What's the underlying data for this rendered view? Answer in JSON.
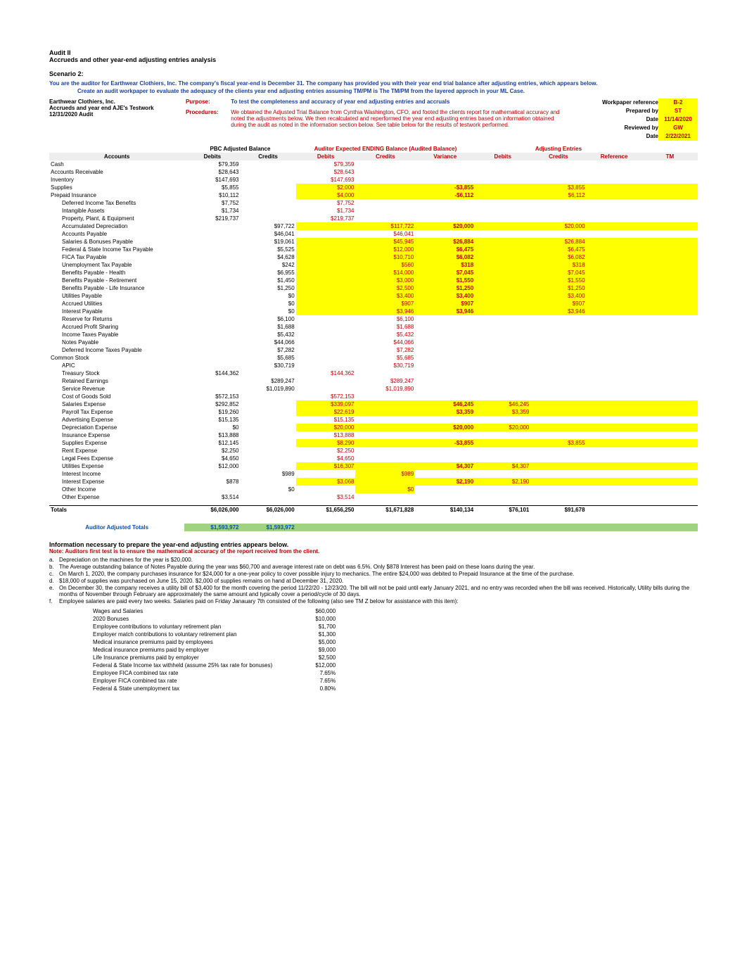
{
  "header": {
    "line1": "Audit II",
    "line2": "Accrueds and other year-end adjusting entries analysis",
    "scenario": "Scenario 2:",
    "intro1": "You are the auditor for Earthwear Clothiers, Inc. The company's fiscal year-end is December 31. The company has provided you with their year end trial balance after adjusting entries, which appears below.",
    "intro2": "Create an audit workpaper to evaluate the adequacy of the clients year end adjusting entries assuming TM/PM is The TM/PM from the layered approch in your ML Case."
  },
  "client": {
    "name": "Earthwear Clothiers, Inc.",
    "sub1": "Accrueds and year end AJE's Testwork",
    "sub2": "12/31/2020 Audit"
  },
  "purpose": {
    "label": "Purpose:",
    "text": "To test the completeness and accuracy of year end adjusting entries and accruals"
  },
  "procedures": {
    "label": "Procedures:",
    "text": "We obtained the Adjusted Trial Balance from Cynthia Washington, CFO, and footed the clients report for mathematical accuracy and noted the adjustments below.   We then recalculated and reperformed the year end adjusting entries based on information obtained during the audit as noted in the information section below.   See table below for the results of testwork performed."
  },
  "wp": {
    "labels": [
      "Workpaper reference",
      "Prepared by",
      "Date",
      "Reviewed by",
      "Date"
    ],
    "values": [
      "B-2",
      "ST",
      "11/14/2020",
      "GW",
      "2/22/2021"
    ]
  },
  "section_headers": {
    "pbc": "PBC Adjusted Balance",
    "aud": "Auditor Expected ENDING Balance (Audited Balance)",
    "adj": "Adjusting Entries"
  },
  "columns": {
    "acct": "Accounts",
    "d1": "Debits",
    "c1": "Credits",
    "d2": "Debits",
    "c2": "Credits",
    "var": "Variance",
    "d3": "Debits",
    "c3": "Credits",
    "ref": "Reference",
    "tm": "TM"
  },
  "rows": [
    {
      "acct": "Cash",
      "d1": "$79,359",
      "d2": "$79,359"
    },
    {
      "acct": "Accounts Receivable",
      "d1": "$28,643",
      "d2": "$28,643"
    },
    {
      "acct": "Inventory",
      "d1": "$147,693",
      "d2": "$147,693"
    },
    {
      "acct": "Supplies",
      "d1": "$5,855",
      "d2": "$2,000",
      "var": "-$3,855",
      "c3": "$3,855",
      "hl": "y"
    },
    {
      "acct": "Prepaid Insurance",
      "d1": "$10,112",
      "d2": "$4,000",
      "var": "-$6,112",
      "c3": "$6,112",
      "hl": "y"
    },
    {
      "acct": "Deferred Income Tax Benefits",
      "ind": true,
      "d1": "$7,752",
      "d2": "$7,752"
    },
    {
      "acct": "Intangible Assets",
      "ind": true,
      "d1": "$1,734",
      "d2": "$1,734"
    },
    {
      "acct": "Property, Plant, & Equipment",
      "ind": true,
      "d1": "$219,737",
      "d2": "$219,737"
    },
    {
      "acct": "Accumulated Depreciation",
      "ind": true,
      "c1": "$97,722",
      "c2": "$117,722",
      "var": "$20,000",
      "c3": "$20,000",
      "hl": "y"
    },
    {
      "acct": "Accounts Payable",
      "ind": true,
      "c1": "$46,041",
      "c2": "$46,041"
    },
    {
      "acct": "Salaries & Bonuses Payable",
      "ind": true,
      "c1": "$19,061",
      "c2": "$45,945",
      "var": "$26,884",
      "c3": "$26,884",
      "hl": "y"
    },
    {
      "acct": "Federal & State Income Tax Payable",
      "ind": true,
      "c1": "$5,525",
      "c2": "$12,000",
      "var": "$6,475",
      "c3": "$6,475",
      "hl": "y"
    },
    {
      "acct": "FICA Tax Payable",
      "ind": true,
      "c1": "$4,628",
      "c2": "$10,710",
      "var": "$6,082",
      "c3": "$6,082",
      "hl": "y"
    },
    {
      "acct": "Unemployment Tax Payable",
      "ind": true,
      "c1": "$242",
      "c2": "$560",
      "var": "$318",
      "c3": "$318",
      "hl": "y"
    },
    {
      "acct": "Benefits Payable - Health",
      "ind": true,
      "c1": "$6,955",
      "c2": "$14,000",
      "var": "$7,045",
      "c3": "$7,045",
      "hl": "y"
    },
    {
      "acct": "Benefits Payable - Retirement",
      "ind": true,
      "c1": "$1,450",
      "c2": "$3,000",
      "var": "$1,550",
      "c3": "$1,550",
      "hl": "y"
    },
    {
      "acct": "Benefits Payable - Life Insurance",
      "ind": true,
      "c1": "$1,250",
      "c2": "$2,500",
      "var": "$1,250",
      "c3": "$1,250",
      "hl": "y"
    },
    {
      "acct": "Utilities Payable",
      "ind": true,
      "c1": "$0",
      "c2": "$3,400",
      "var": "$3,400",
      "c3": "$3,400",
      "hl": "y"
    },
    {
      "acct": "Accrued Utilities",
      "ind": true,
      "c1": "$0",
      "c2": "$907",
      "var": "$907",
      "c3": "$907",
      "hl": "y"
    },
    {
      "acct": "Interest Payable",
      "ind": true,
      "c1": "$0",
      "c2": "$3,946",
      "var": "$3,946",
      "c3": "$3,946",
      "hl": "y"
    },
    {
      "acct": "Reserve for Returns",
      "ind": true,
      "c1": "$6,100",
      "c2": "$6,100"
    },
    {
      "acct": "Accrued Profit Sharing",
      "ind": true,
      "c1": "$1,688",
      "c2": "$1,688"
    },
    {
      "acct": "Income Taxes Payable",
      "ind": true,
      "c1": "$5,432",
      "c2": "$5,432"
    },
    {
      "acct": "Notes Payable",
      "ind": true,
      "c1": "$44,066",
      "c2": "$44,066"
    },
    {
      "acct": "Deferred Income Taxes Payable",
      "ind": true,
      "c1": "$7,282",
      "c2": "$7,282"
    },
    {
      "acct": "Common Stock",
      "c1": "$5,685",
      "c2": "$5,685"
    },
    {
      "acct": "APIC",
      "ind": true,
      "c1": "$30,719",
      "c2": "$30,719"
    },
    {
      "acct": "Treasury Stock",
      "ind": true,
      "d1": "$144,362",
      "d2": "$144,362"
    },
    {
      "acct": "Retained Earnings",
      "ind": true,
      "c1": "$289,247",
      "c2": "$289,247"
    },
    {
      "acct": "Service Revenue",
      "ind": true,
      "c1": "$1,019,890",
      "c2": "$1,019,890"
    },
    {
      "acct": "Cost of Goods Sold",
      "ind": true,
      "d1": "$572,153",
      "d2": "$572,153"
    },
    {
      "acct": "Salaries Expense",
      "ind": true,
      "d1": "$292,852",
      "d2": "$339,097",
      "var": "$46,245",
      "d3": "$46,245",
      "hl": "y"
    },
    {
      "acct": "Payroll Tax Expense",
      "ind": true,
      "d1": "$19,260",
      "d2": "$22,619",
      "var": "$3,359",
      "d3": "$3,359",
      "hl": "y"
    },
    {
      "acct": "Advertising Expense",
      "ind": true,
      "d1": "$15,135",
      "d2": "$15,135"
    },
    {
      "acct": "Depreciation Expense",
      "ind": true,
      "d1": "$0",
      "d2": "$20,000",
      "var": "$20,000",
      "d3": "$20,000",
      "hl": "y"
    },
    {
      "acct": "Insurance Expense",
      "ind": true,
      "d1": "$13,888",
      "d2": "$13,888"
    },
    {
      "acct": "Supplies Expense",
      "ind": true,
      "d1": "$12,145",
      "d2": "$8,290",
      "var": "-$3,855",
      "c3": "$3,855",
      "hl": "y"
    },
    {
      "acct": "Rent Expense",
      "ind": true,
      "d1": "$2,250",
      "d2": "$2,250"
    },
    {
      "acct": "Legal Fees Expense",
      "ind": true,
      "d1": "$4,650",
      "d2": "$4,650"
    },
    {
      "acct": "Utilities Expense",
      "ind": true,
      "d1": "$12,000",
      "d2": "$16,307",
      "var": "$4,307",
      "d3": "$4,307",
      "hl": "y"
    },
    {
      "acct": "Interest Income",
      "ind": true,
      "c1": "$989",
      "c2": "$989",
      "hlc2": "y"
    },
    {
      "acct": "Interest Expense",
      "ind": true,
      "d1": "$878",
      "d2": "$3,068",
      "var": "$2,190",
      "d3": "$2,190",
      "hl": "y"
    },
    {
      "acct": "Other Income",
      "ind": true,
      "c1": "$0",
      "c2": "$0",
      "hlc2": "y"
    },
    {
      "acct": "Other Expense",
      "ind": true,
      "d1": "$3,514",
      "d2": "$3,514"
    }
  ],
  "totals": {
    "label": "Totals",
    "d1": "$6,026,000",
    "c1": "$6,026,000",
    "d2": "$1,656,250",
    "c2": "$1,671,828",
    "var": "$140,134",
    "d3": "$76,101",
    "c3": "$91,678"
  },
  "aud_totals": {
    "label": "Auditor Adjusted Totals",
    "d1": "$1,593,972",
    "c1": "$1,593,972"
  },
  "info": {
    "hdr": "Information necessary to prepare the year-end adjusting entries appears below.",
    "note": "Note: Auditors first test is to ensure the mathematical accuracy of the report received from the client.",
    "items": [
      {
        "l": "a.",
        "t": "Depreciation on the machines for the year is $20,000."
      },
      {
        "l": "b.",
        "t": "The Average outstanding balance of Notes Payable during the year was $60,700 and average interest rate on debt was 6.5%.  Only $878  Interest has been paid on these loans during the year."
      },
      {
        "l": "c.",
        "t": "On March 1, 2020, the company purchases insurance for $24,000 for a one-year policy to cover possible injury to mechanics. The entire $24,000 was debited to Prepaid Insurance at the time of the purchase."
      },
      {
        "l": "d.",
        "t": "$18,000 of supplies was purchased on June 15, 2020. $2,000 of supplies remains on hand at December 31, 2020."
      },
      {
        "l": "e.",
        "t": "On December 30, the company receives a utility bill of $3,400 for the month covering the period 11/22/20 - 12/23/20. The bill will not be paid until early January 2021, and no entry was recorded when the bill was received.  Historically, Utility bills during the months of November through February are approximately the same amount and typically cover a period/cycle of 30 days."
      },
      {
        "l": "f.",
        "t": "Employee salaries are paid every two weeks. Salaries paid on Friday Janauary 7th consisted of the following (also see TM Z below for assistance with this item):"
      }
    ]
  },
  "payroll": [
    {
      "k": "Wages and Salaries",
      "v": "$60,000"
    },
    {
      "k": "2020 Bonuses",
      "v": "$10,000"
    },
    {
      "k": "Employee contributions to voluntary retirement plan",
      "v": "$1,700"
    },
    {
      "k": "Employer match contributions to voluntary retirement plan",
      "v": "$1,300"
    },
    {
      "k": "Medical insurance premiums paid by employees",
      "v": "$5,000"
    },
    {
      "k": "Medical insurance premiums paid by employer",
      "v": "$9,000"
    },
    {
      "k": "Life Insurance premiums paid by employer",
      "v": "$2,500"
    },
    {
      "k": "Federal & State Income tax withheld (assume 25% tax rate for bonuses)",
      "v": "$12,000"
    },
    {
      "k": "Employee FICA combined tax rate",
      "v": "7.65%"
    },
    {
      "k": "Employer FICA combined tax rate",
      "v": "7.65%"
    },
    {
      "k": "Federal & State unemployment tax",
      "v": "0.80%"
    }
  ]
}
